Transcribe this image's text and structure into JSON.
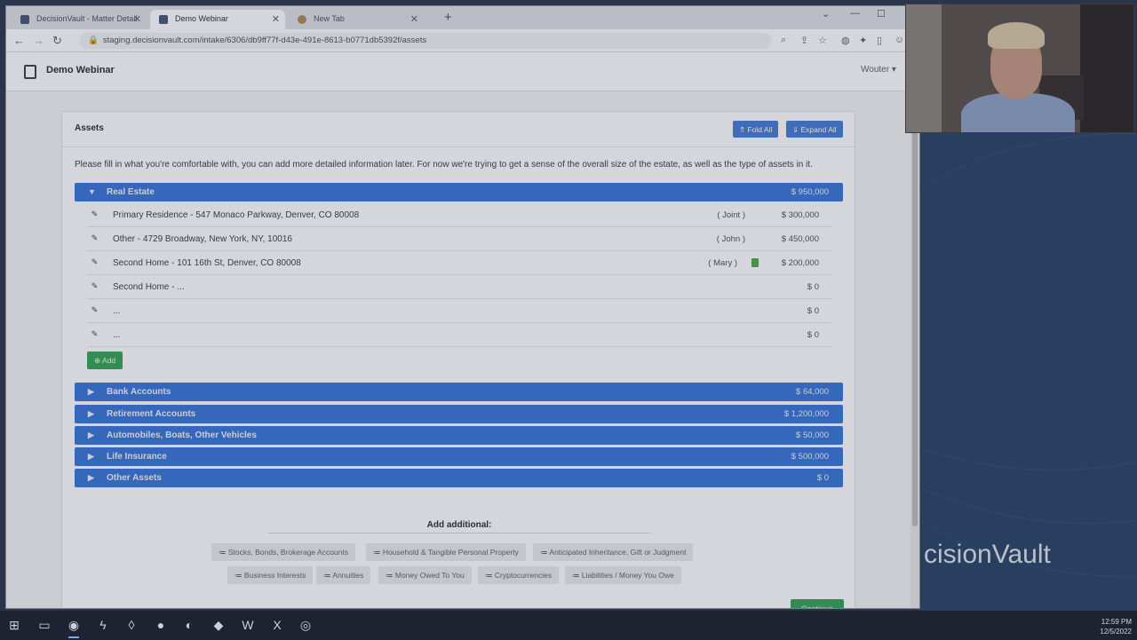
{
  "browser": {
    "tabs": [
      {
        "title": "DecisionVault - Matter Detail",
        "active": false
      },
      {
        "title": "Demo Webinar",
        "active": true
      },
      {
        "title": "New Tab",
        "active": false
      }
    ],
    "url": "staging.decisionvault.com/intake/6306/db9ff77f-d43e-491e-8613-b0771db5392f/assets"
  },
  "app": {
    "name": "Demo Webinar",
    "user": "Wouter"
  },
  "assets": {
    "title": "Assets",
    "fold_all": "Fold All",
    "expand_all": "Expand All",
    "intro": "Please fill in what you're comfortable with, you can add more detailed information later. For now we're trying to get a sense of the overall size of the estate, as well as the type of assets in it.",
    "real_estate": {
      "label": "Real Estate",
      "total": "$ 950,000",
      "rows": [
        {
          "desc": "Primary Residence - 547 Monaco Parkway, Denver, CO 80008",
          "owner": "( Joint )",
          "value": "$ 300,000"
        },
        {
          "desc": "Other - 4729 Broadway, New York, NY, 10016",
          "owner": "( John )",
          "value": "$ 450,000"
        },
        {
          "desc": "Second Home - 101 16th St, Denver, CO 80008",
          "owner": "( Mary )",
          "value": "$ 200,000"
        },
        {
          "desc": "Second Home - ...",
          "owner": "",
          "value": "$ 0"
        },
        {
          "desc": "...",
          "owner": "",
          "value": "$ 0"
        },
        {
          "desc": "...",
          "owner": "",
          "value": "$ 0"
        }
      ],
      "add_label": "Add"
    },
    "categories": [
      {
        "label": "Bank Accounts",
        "total": "$ 64,000"
      },
      {
        "label": "Retirement Accounts",
        "total": "$ 1,200,000"
      },
      {
        "label": "Automobiles, Boats, Other Vehicles",
        "total": "$ 50,000"
      },
      {
        "label": "Life Insurance",
        "total": "$ 500,000"
      },
      {
        "label": "Other Assets",
        "total": "$ 0"
      }
    ],
    "add_additional": {
      "title": "Add additional:",
      "chips": [
        "Stocks, Bonds, Brokerage Accounts",
        "Household & Tangible Personal Property",
        "Anticipated Inheritance, Gift or Judgment",
        "Business Interests",
        "Annuities",
        "Money Owed To You",
        "Cryptocurrencies",
        "Liabilities / Money You Owe"
      ]
    },
    "continue_label": "Continue"
  },
  "slide": {
    "brand_text": "cisionVault"
  },
  "taskbar": {
    "time": "12:59 PM",
    "date": "12/5/2022"
  }
}
